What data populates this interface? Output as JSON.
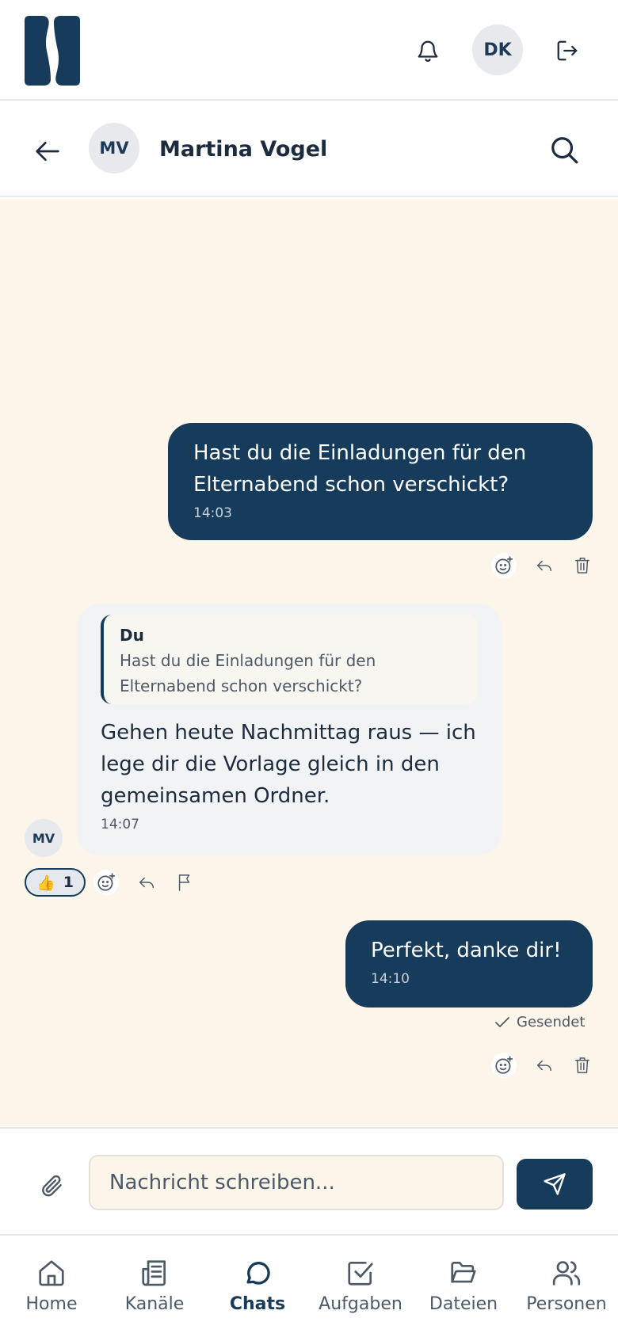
{
  "header": {
    "avatar_initials": "DK"
  },
  "chat_header": {
    "contact_initials": "MV",
    "contact_name": "Martina Vogel"
  },
  "messages": [
    {
      "direction": "out",
      "text": "Hast du die Einladungen für den Elternabend schon verschickt?",
      "time": "14:03"
    },
    {
      "direction": "in",
      "quote_author": "Du",
      "quote_text": "Hast du die Einladungen für den Elternabend schon verschickt?",
      "text": "Gehen heute Nachmittag raus — ich lege dir die Vorlage gleich in den gemeinsamen Ordner.",
      "time": "14:07",
      "sender_initials": "MV",
      "reaction": {
        "emoji": "👍",
        "count": "1"
      }
    },
    {
      "direction": "out",
      "text": "Perfekt, danke dir!",
      "time": "14:10",
      "status": "Gesendet"
    }
  ],
  "composer": {
    "placeholder": "Nachricht schreiben..."
  },
  "tabs": [
    {
      "label": "Home",
      "icon": "home-icon"
    },
    {
      "label": "Kanäle",
      "icon": "newspaper-icon"
    },
    {
      "label": "Chats",
      "icon": "chat-bubble-icon",
      "active": true
    },
    {
      "label": "Aufgaben",
      "icon": "checkbox-icon"
    },
    {
      "label": "Dateien",
      "icon": "folder-icon"
    },
    {
      "label": "Personen",
      "icon": "people-icon"
    }
  ],
  "colors": {
    "primary": "#173b5b",
    "thread_bg": "#fcf5ea",
    "incoming_bg": "#f2f3f5"
  }
}
